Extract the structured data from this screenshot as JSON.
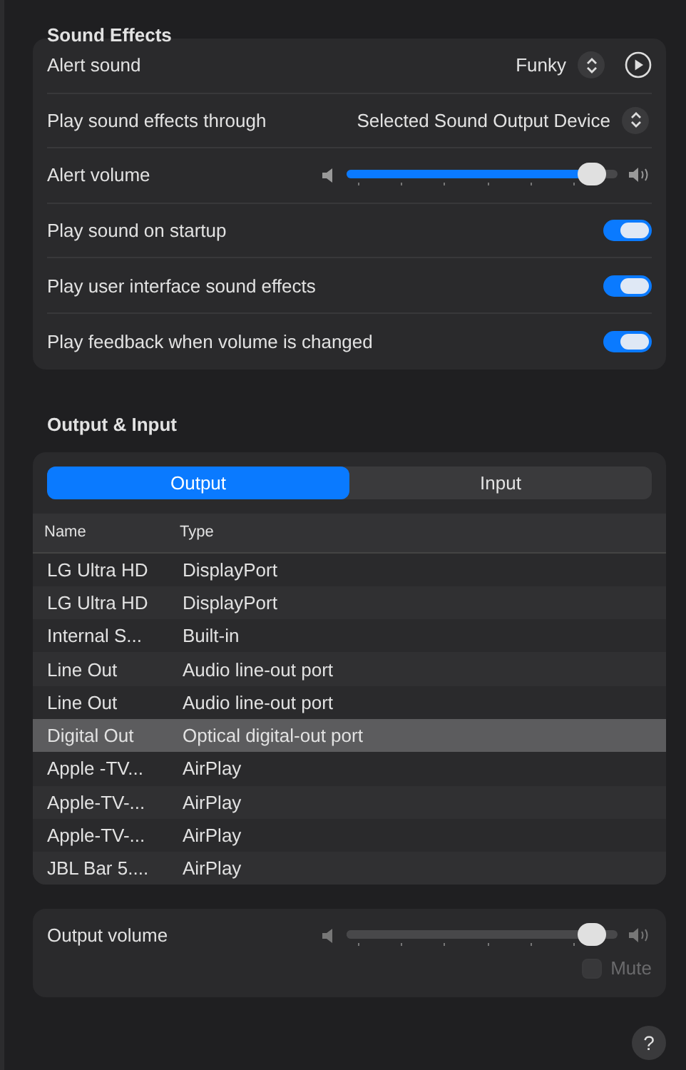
{
  "sound_effects": {
    "title": "Sound Effects",
    "rows": [
      {
        "kind": "popup",
        "label": "Alert sound",
        "value": "Funky",
        "play_button": true
      },
      {
        "kind": "popup",
        "label": "Play sound effects through",
        "value": "Selected Sound Output Device"
      },
      {
        "kind": "slider",
        "label": "Alert volume",
        "level": 0.95,
        "disabled": false
      },
      {
        "kind": "toggle",
        "label": "Play sound on startup",
        "on": true
      },
      {
        "kind": "toggle",
        "label": "Play user interface sound effects",
        "on": true
      },
      {
        "kind": "toggle",
        "label": "Play feedback when volume is changed",
        "on": true
      }
    ]
  },
  "output_input": {
    "title": "Output & Input",
    "tabs": [
      {
        "label": "Output",
        "selected": true
      },
      {
        "label": "Input",
        "selected": false
      }
    ],
    "table": {
      "columns": [
        "Name",
        "Type"
      ],
      "rows": [
        {
          "name": "LG Ultra HD",
          "type": "DisplayPort",
          "selected": false
        },
        {
          "name": "LG Ultra HD",
          "type": "DisplayPort",
          "selected": false
        },
        {
          "name": "Internal S...",
          "type": "Built-in",
          "selected": false
        },
        {
          "name": "Line Out",
          "type": "Audio line-out port",
          "selected": false
        },
        {
          "name": "Line Out",
          "type": "Audio line-out port",
          "selected": false
        },
        {
          "name": "Digital Out",
          "type": "Optical digital-out port",
          "selected": true
        },
        {
          "name": "Apple -TV...",
          "type": "AirPlay",
          "selected": false
        },
        {
          "name": "Apple-TV-...",
          "type": "AirPlay",
          "selected": false
        },
        {
          "name": "Apple-TV-...",
          "type": "AirPlay",
          "selected": false
        },
        {
          "name": "JBL Bar 5....",
          "type": "AirPlay",
          "selected": false
        }
      ]
    }
  },
  "output_volume": {
    "label": "Output volume",
    "level": 0.95,
    "disabled": true,
    "mute": {
      "label": "Mute",
      "checked": false,
      "disabled": true
    }
  },
  "help": "?"
}
